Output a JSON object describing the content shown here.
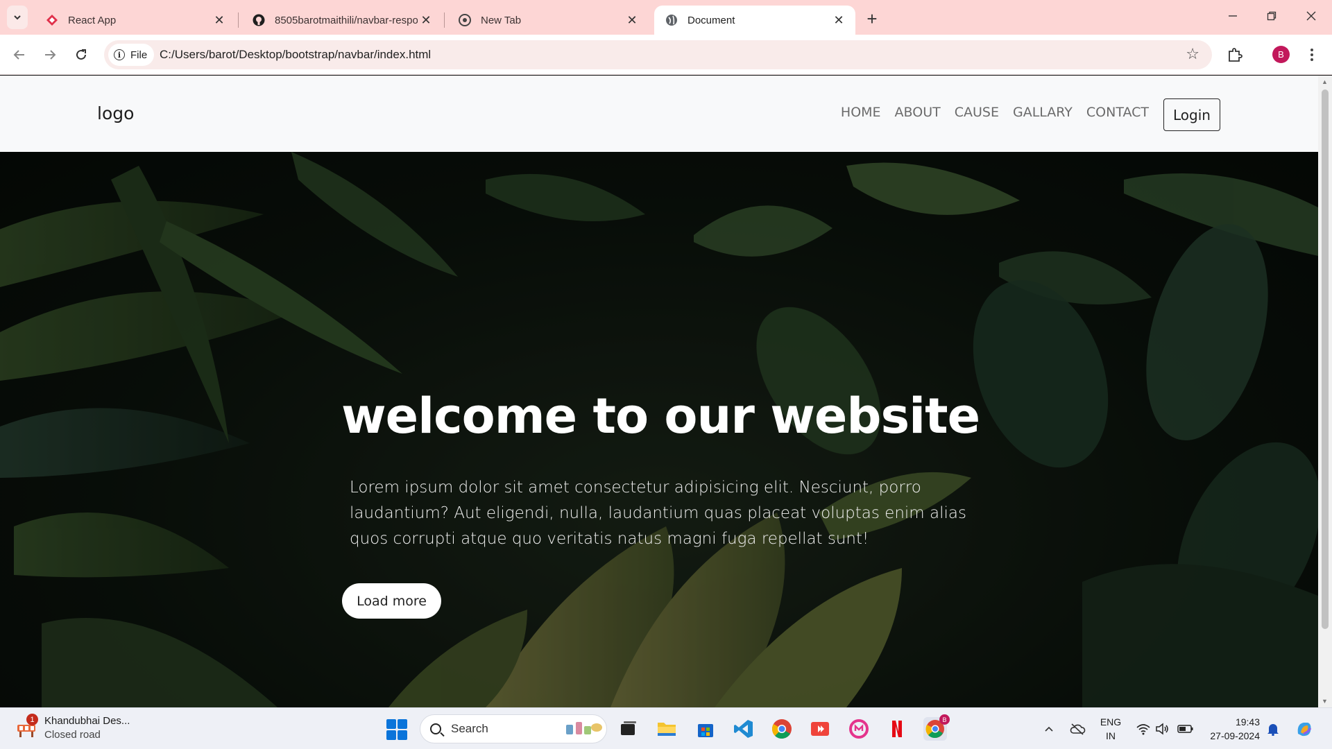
{
  "browser": {
    "tabs": [
      {
        "title": "React App",
        "favicon": "react-app-icon"
      },
      {
        "title": "8505barotmaithili/navbar-respo",
        "favicon": "github-icon"
      },
      {
        "title": "New Tab",
        "favicon": "chrome-icon"
      },
      {
        "title": "Document",
        "favicon": "globe-icon",
        "active": true
      }
    ],
    "site_chip": "File",
    "url": "C:/Users/barot/Desktop/bootstrap/navbar/index.html",
    "profile_initial": "B"
  },
  "page": {
    "logo": "logo",
    "nav": [
      "HOME",
      "ABOUT",
      "CAUSE",
      "GALLARY",
      "CONTACT"
    ],
    "login_label": "Login",
    "hero": {
      "title": "welcome to our website",
      "text": "Lorem ipsum dolor sit amet consectetur adipisicing elit. Nesciunt, porro laudantium? Aut eligendi, nulla, laudantium quas placeat voluptas enim alias quos corrupti atque quo veritatis natus magni fuga repellat sunt!",
      "button_label": "Load more"
    }
  },
  "taskbar": {
    "weather": {
      "badge": "1",
      "title": "Khandubhai Des...",
      "subtitle": "Closed road"
    },
    "search_placeholder": "Search",
    "chrome_badge": "B",
    "lang_line1": "ENG",
    "lang_line2": "IN",
    "time": "19:43",
    "date": "27-09-2024"
  },
  "colors": {
    "tabstrip": "#fdd6d5",
    "navbar_bg": "#f8f9fa",
    "avatar": "#c2185b",
    "hero_bg": "#0c140d"
  }
}
